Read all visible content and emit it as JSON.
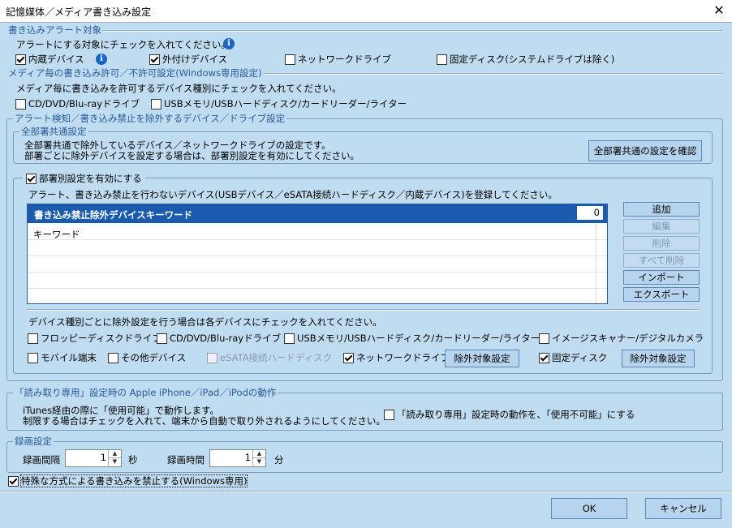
{
  "window": {
    "title": "記憶媒体／メディア書き込み設定",
    "close_label": "✕"
  },
  "alert_target": {
    "caption": "書き込みアラート対象",
    "instruction": "アラートにする対象にチェックを入れてください。",
    "items": [
      {
        "label": "内蔵デバイス",
        "checked": true
      },
      {
        "label": "外付けデバイス",
        "checked": true
      },
      {
        "label": "ネットワークドライブ",
        "checked": false
      },
      {
        "label": "固定ディスク(システムドライブは除く)",
        "checked": false
      }
    ]
  },
  "media_write": {
    "caption": "メディア毎の書き込み許可／不許可設定(Windows専用設定)",
    "instruction": "メディア毎に書き込みを許可するデバイス種別にチェックを入れてください。",
    "items": [
      {
        "label": "CD/DVD/Blu-rayドライブ",
        "checked": false
      },
      {
        "label": "USBメモリ/USBハードディスク/カードリーダー/ライター",
        "checked": false
      }
    ]
  },
  "exclusion": {
    "caption": "アラート検知／書き込み禁止を除外するデバイス／ドライブ設定",
    "common": {
      "caption": "全部署共通設定",
      "line1": "全部署共通で除外しているデバイス／ネットワークドライブの設定です。",
      "line2": "部署ごとに除外デバイスを設定する場合は、部署別設定を有効にしてください。",
      "confirm_button": "全部署共通の設定を確認"
    },
    "dept": {
      "enable_label": "部署別設定を有効にする",
      "enable_checked": true,
      "instruction": "アラート、書き込み禁止を行わないデバイス(USBデバイス／eSATA接続ハードディスク／内蔵デバイス)を登録してください。",
      "list_header": "書き込み禁止除外デバイスキーワード",
      "count": "0",
      "placeholder_row": "キーワード",
      "buttons": {
        "add": "追加",
        "edit": "編集",
        "delete": "削除",
        "delete_all": "すべて削除",
        "import": "インポート",
        "export": "エクスポート"
      },
      "device_instruction": "デバイス種別ごとに除外設定を行う場合は各デバイスにチェックを入れてください。",
      "devices_row1": [
        {
          "label": "フロッピーディスクドライブ",
          "checked": false
        },
        {
          "label": "CD/DVD/Blu-rayドライブ",
          "checked": false
        },
        {
          "label": "USBメモリ/USBハードディスク/カードリーダー/ライター",
          "checked": false
        },
        {
          "label": "イメージスキャナー/デジタルカメラ",
          "checked": false
        }
      ],
      "devices_row2": [
        {
          "label": "モバイル端末",
          "checked": false
        },
        {
          "label": "その他デバイス",
          "checked": false
        },
        {
          "label": "eSATA接続ハードディスク",
          "checked": false,
          "disabled": true
        },
        {
          "label": "ネットワークドライブ",
          "checked": true
        },
        {
          "label": "固定ディスク",
          "checked": true
        }
      ],
      "exclude_setting_button": "除外対象設定"
    }
  },
  "iphone": {
    "caption": "「読み取り専用」設定時の Apple iPhone／iPad／iPodの動作",
    "line1": "iTunes経由の際に「使用可能」で動作します。",
    "line2": "制限する場合はチェックを入れて、端末から自動で取り外されるようにしてください。",
    "option_label": "「読み取り専用」設定時の動作を、「使用不可能」にする",
    "option_checked": false
  },
  "recording": {
    "caption": "録画設定",
    "interval_label": "録画間隔",
    "interval_value": "1",
    "interval_unit": "秒",
    "duration_label": "録画時間",
    "duration_value": "1",
    "duration_unit": "分"
  },
  "special_write": {
    "label": "特殊な方式による書き込みを禁止する(Windows専用)",
    "checked": true
  },
  "footer": {
    "ok": "OK",
    "cancel": "キャンセル"
  },
  "icons": {
    "info": "info-icon",
    "close": "close-icon",
    "spin_up": "▲",
    "spin_down": "▼"
  }
}
